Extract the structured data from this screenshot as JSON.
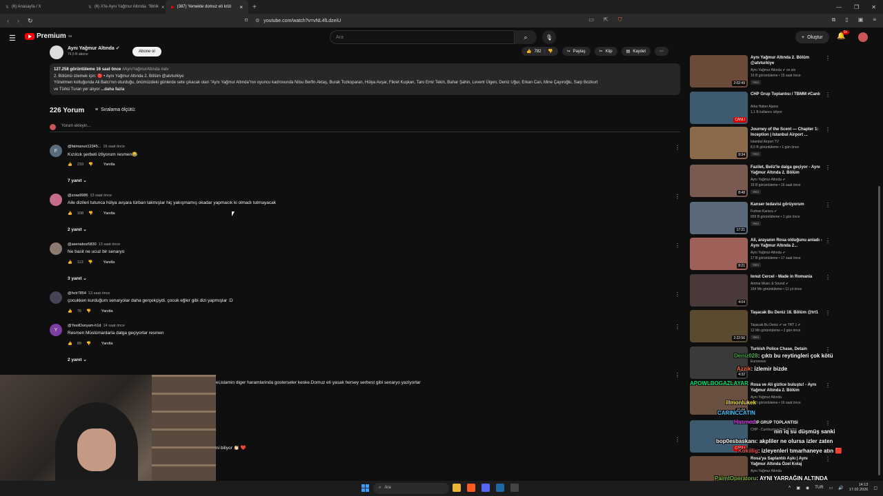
{
  "browser": {
    "tabs": [
      {
        "label": "(6) Anasayfa / X"
      },
      {
        "label": "(6) X'te Aynı Yağmur Altında: \"Birlik"
      },
      {
        "label": "(387) Yemekte domuz eti krizi"
      }
    ],
    "url": "youtube.com/watch?v=vNL4fLdzeiU"
  },
  "masthead": {
    "logo_text": "Premium",
    "logo_sup": "TR",
    "search_placeholder": "Ara",
    "create_label": "Oluştur",
    "notif_badge": "9+"
  },
  "channel": {
    "name": "Aynı Yağmur Altında",
    "subs": "74,5 B abone",
    "subscribe_label": "Abone ol",
    "likes": "782",
    "share_label": "Paylaş",
    "clip_label": "Klip",
    "save_label": "Kaydet"
  },
  "description": {
    "stats": "127.258 görüntüleme  16 saat önce",
    "tags": "#AynıYağmurAltında #atv",
    "line1": "2. Bölümü izlemek için: 🔴 • Aynı Yağmur Altında 2. Bölüm @atvturkiye",
    "line2": "Yönetmen koltuğunda Ali Balcı'nın oturduğu, önümüzdeki günlerde sete çıkacak olan \"Aynı Yağmur Altında\"nın oyuncu kadrosunda Nilsu Berfin Aktaş, Burak Tozkoparan, Hülya Avşar, Fikret Kuşkan, Taro Emir Tekin, Bahar Şahin, Levent Ülgen, Deniz Uğur, Erkan Can, Mine Çayıroğlu, Sarp Bozkurt",
    "line3": "ve Türkü Turan yer alıyor",
    "more": "...daha fazla"
  },
  "comments_header": {
    "count": "226 Yorum",
    "sort_label": "Sıralama ölçütü:",
    "add_placeholder": "Yorum ekleyin..."
  },
  "comments": [
    {
      "author": "@fatmanuri12345...",
      "time": "16 saat önce",
      "text": "Kızılcık şerbeti izliyorum resmen😂",
      "likes": "233",
      "reply": "Yanıtla",
      "replies": "7 yanıt",
      "avatar_letter": "F",
      "avatar_color": "#5a6b7a"
    },
    {
      "author": "@zzaa9986",
      "time": "13 saat önce",
      "text": "Aile dizileri tutunca hülya avşara türban takmışlar hiç yakışmamış okadar yapmacık ki olmadı tutmayacak",
      "likes": "108",
      "reply": "Yanıtla",
      "replies": "2 yanıt",
      "avatar_letter": "",
      "avatar_color": "#c76b8a"
    },
    {
      "author": "@asenaboz5830",
      "time": "13 saat önce",
      "text": "Ne basit ne ucuz bir senaryo",
      "likes": "113",
      "reply": "Yanıtla",
      "replies": "3 yanıt",
      "avatar_letter": "",
      "avatar_color": "#8a7a70"
    },
    {
      "author": "@hctr7854",
      "time": "13 saat önce",
      "text": "çocukken kurduğum senaryolar daha gerçekçiydi. çocuk eğler gibi dizi yapmışlar :D",
      "likes": "76",
      "reply": "Yanıtla",
      "replies": "",
      "avatar_letter": "",
      "avatar_color": "#445"
    },
    {
      "author": "@YesilDunyam-h1d",
      "time": "14 saat önce",
      "text": "Resmen Müslümanlarla dalga geçiyorlar resmen",
      "likes": "89",
      "reply": "Yanıtla",
      "replies": "2 yanıt",
      "avatar_letter": "Y",
      "avatar_color": "#7b3fa0"
    }
  ],
  "overflow_texts": {
    "t1": "ei,islamin diger haramlarinda gosterseler keske.Domuz eti yasak hersey serbest gibi senaryo yaziyorlar",
    "t2": "ni biliyor 👏🏻 ❤️"
  },
  "sidebar": [
    {
      "title": "Aynı Yağmur Altında 2. Bölüm @atvturkiye",
      "channel": "Aynı Yağmur Altında ✔ ve atv",
      "meta": "16 B görüntüleme • 15 saat önce",
      "duration": "2:02:49",
      "new": "Yeni",
      "thumb": "#6b4a3a",
      "live": false
    },
    {
      "title": "CHP Grup Toplantısı / TBMM #Canlı",
      "channel": "Arka Haber Ajansı",
      "meta": "1,1 B kullanıcı izliyor",
      "duration": "CANLI",
      "new": "",
      "thumb": "#3d5a6e",
      "live": true
    },
    {
      "title": "Journey of the Scent — Chapter 1: Inception | Istanbul Airport ...",
      "channel": "Istanbul Airport TV",
      "meta": "8,5 B görüntüleme • 1 gün önce",
      "duration": "8:34",
      "new": "Yeni",
      "thumb": "#8a6a4a",
      "live": false
    },
    {
      "title": "Fazilet, Beliz'le dalga geçiyor - Aynı Yağmur Altında 2. Bölüm",
      "channel": "Aynı Yağmur Altında ✔",
      "meta": "18 B görüntüleme • 16 saat önce",
      "duration": "8:48",
      "new": "Yeni",
      "thumb": "#7a5a50",
      "live": false
    },
    {
      "title": "Kanser tedavisi görüyorum",
      "channel": "Furkan Karaca ✔",
      "meta": "659 B görüntüleme • 1 gün önce",
      "duration": "17:21",
      "new": "Yeni",
      "thumb": "#5a6a7a",
      "live": false
    },
    {
      "title": "Ali, arayanın Rosa olduğunu anladı - Aynı Yağmur Altında 2...",
      "channel": "Aynı Yağmur Altında ✔",
      "meta": "17 B görüntüleme • 17 saat önce",
      "duration": "8:21",
      "new": "Yeni",
      "thumb": "#a0605a",
      "live": false
    },
    {
      "title": "Ionut Cercel - Made in Romania",
      "channel": "Amma Music & Sound ✔",
      "meta": "164 Mn görüntüleme • 11 yıl önce",
      "duration": "4:04",
      "new": "",
      "thumb": "#4a3a3a",
      "live": false
    },
    {
      "title": "Taşacak Bu Deniz 18. Bölüm @trt1",
      "channel": "Taşacak Bu Deniz ✔ ve TRT 1 ✔",
      "meta": "12 Mn görüntüleme • 3 gün önce",
      "duration": "2:22:56",
      "new": "Yeni",
      "thumb": "#5a4a30",
      "live": false
    },
    {
      "title": "Turkish Police Chase, Detain",
      "channel": "Euronews",
      "meta": "",
      "duration": "4:32",
      "new": "",
      "thumb": "#3a3a3a",
      "live": false
    },
    {
      "title": "Rosa ve Ali gizlice buluştu! - Aynı Yağmur Altında 2. Bölüm",
      "channel": "Aynı Yağmur Altında",
      "meta": "18 B görüntüleme • 16 saat önce",
      "duration": "11:08",
      "new": "",
      "thumb": "#6a5040",
      "live": false
    },
    {
      "title": "CHP GRUP TOPLANTISI",
      "channel": "CHP - Cumhuriyet Halk Partisi",
      "meta": "",
      "duration": "CANLI",
      "new": "",
      "thumb": "#3d5a6e",
      "live": true
    },
    {
      "title": "Rosa'ya Saplantılı Aşkı | Aynı Yağmur Altında Özel Kolaj",
      "channel": "Aynı Yağmur Altında",
      "meta": "",
      "duration": "",
      "new": "",
      "thumb": "#6a4a3a",
      "live": false
    }
  ],
  "chat_overlay": [
    {
      "user": "Deniz028",
      "msg": "çıktı bu reytingleri çok kötü",
      "user_color": "#4caf50"
    },
    {
      "user": "Azzik",
      "msg": "izlemir bizde",
      "user_color": "#ff7043"
    },
    {
      "user": "APOWLBOGAZLAYAR",
      "msg": "",
      "user_color": "#00e676"
    },
    {
      "user": "illmonlukek",
      "msg": "",
      "user_color": "#ffeb3b"
    },
    {
      "user": "CARINCCATIN",
      "msg": "",
      "user_color": "#40c4ff"
    },
    {
      "user": "Hasmed",
      "msg": "",
      "user_color": "#e040fb"
    },
    {
      "user": "",
      "msg": "nin iq su düşmüş sanki",
      "user_color": "#fff"
    },
    {
      "user": "bop0esbaskanı",
      "msg": "akpliler ne olursa izler zaten",
      "user_color": "#fff"
    },
    {
      "user": "Kokiilig",
      "msg": "izleyenleri tımarhaneye atın 🟥",
      "user_color": "#fff"
    },
    {
      "user": "PaimtOperatoru",
      "msg": "AYNI YARRAĞIN ALTINDA",
      "user_color": "#7cb342"
    }
  ],
  "taskbar": {
    "search_label": "Ara",
    "lang": "TUR",
    "time": "14:13",
    "date": "17.02.2026"
  }
}
